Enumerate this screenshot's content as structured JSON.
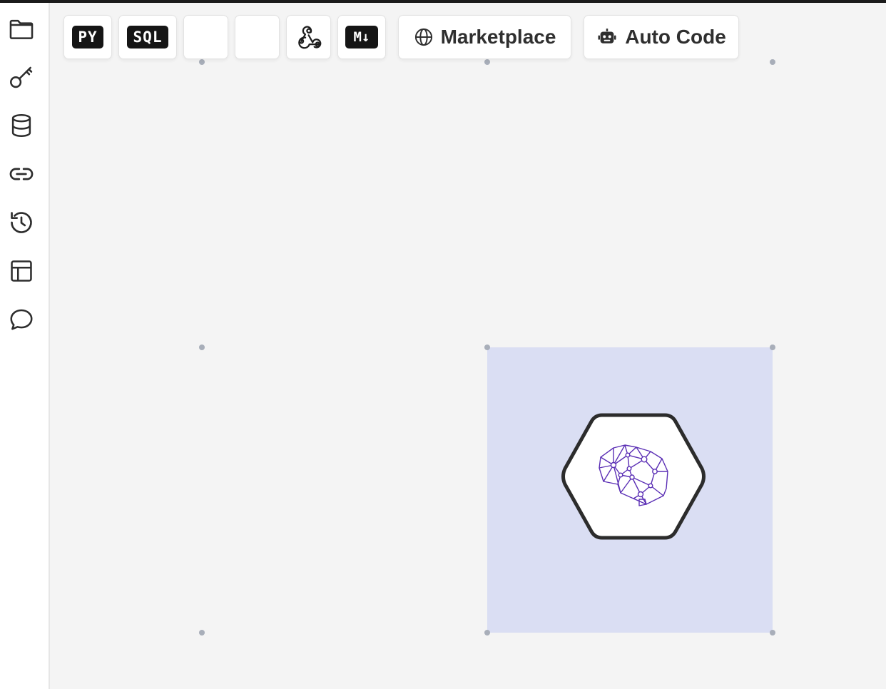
{
  "toolbar": {
    "python_label": "PY",
    "sql_label": "SQL",
    "markdown_label": "M↓",
    "marketplace_label": "Marketplace",
    "autocode_label": "Auto Code"
  },
  "sidebar": {
    "items": [
      {
        "icon": "folder-icon"
      },
      {
        "icon": "key-icon"
      },
      {
        "icon": "database-icon"
      },
      {
        "icon": "link-icon"
      },
      {
        "icon": "history-icon"
      },
      {
        "icon": "layout-icon"
      },
      {
        "icon": "chat-icon"
      }
    ]
  },
  "canvas": {
    "node_icon": "ai-brain-icon",
    "selection_color": "#dadef3",
    "accent": "#5b2fb5"
  }
}
